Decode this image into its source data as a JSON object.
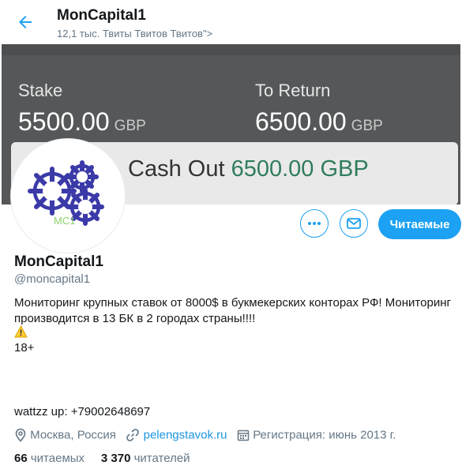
{
  "header": {
    "name": "MonCapital1",
    "subtitle": "12,1 тыс. Твиты Твитов Твитов\">"
  },
  "banner": {
    "stake_label": "Stake",
    "stake_value": "5500.00",
    "stake_unit": "GBP",
    "return_label": "To Return",
    "return_value": "6500.00",
    "return_unit": "GBP",
    "cashout_label": "Cash Out",
    "cashout_value": "6500.00 GBP"
  },
  "avatar": {
    "logo_text": "MC1"
  },
  "actions": {
    "follow_label": "Читаемые"
  },
  "profile": {
    "name": "MonCapital1",
    "handle": "@moncapital1",
    "bio": "Мониторинг  крупных ставок от 8000$ в букмекерских конторах РФ! Мониторинг производится в 13 БК  в 2 городах страны!!!!",
    "age": "18+",
    "phone": "wattzz up: +79002648697",
    "location": "Москва, Россия",
    "website": "pelengstavok.ru",
    "joined": "Регистрация: июнь 2013 г."
  },
  "stats": {
    "following_count": "66",
    "following_label": "читаемых",
    "followers_count": "3 370",
    "followers_label": "читателей"
  },
  "colors": {
    "accent": "#1da1f2",
    "banner": "#555759",
    "logo": "#3b3aa8",
    "logo_text": "#8bd46b"
  }
}
